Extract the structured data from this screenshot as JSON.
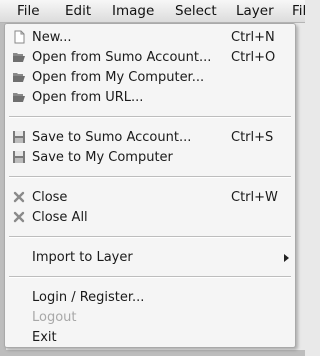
{
  "menubar": {
    "items": [
      {
        "label": "File"
      },
      {
        "label": "Edit"
      },
      {
        "label": "Image"
      },
      {
        "label": "Select"
      },
      {
        "label": "Layer"
      },
      {
        "label": "Fil"
      }
    ]
  },
  "file_menu": {
    "new": {
      "label": "New...",
      "shortcut": "Ctrl+N",
      "icon": "document-icon"
    },
    "open_sumo": {
      "label": "Open from Sumo Account...",
      "shortcut": "Ctrl+O",
      "icon": "folder-open-icon"
    },
    "open_computer": {
      "label": "Open from My Computer...",
      "icon": "folder-open-icon"
    },
    "open_url": {
      "label": "Open from URL...",
      "icon": "folder-open-icon"
    },
    "save_sumo": {
      "label": "Save to Sumo Account...",
      "shortcut": "Ctrl+S",
      "icon": "floppy-disk-icon"
    },
    "save_computer": {
      "label": "Save to My Computer",
      "icon": "floppy-disk-icon"
    },
    "close": {
      "label": "Close",
      "shortcut": "Ctrl+W",
      "icon": "close-x-icon"
    },
    "close_all": {
      "label": "Close All",
      "icon": "close-x-icon"
    },
    "import_layer": {
      "label": "Import to Layer"
    },
    "login": {
      "label": "Login / Register..."
    },
    "logout": {
      "label": "Logout"
    },
    "exit": {
      "label": "Exit"
    }
  }
}
